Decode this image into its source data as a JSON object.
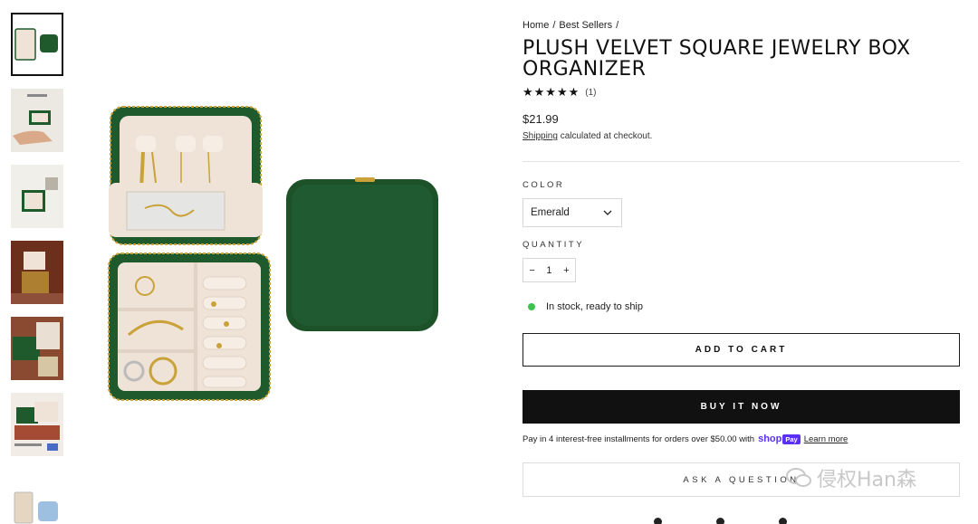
{
  "breadcrumb": [
    "Home",
    "/",
    "Best Sellers",
    "/"
  ],
  "product": {
    "title": "PLUSH VELVET SQUARE JEWELRY BOX ORGANIZER",
    "stars": "★★★★★",
    "review_count": "(1)",
    "price": "$21.99",
    "shipping_link": "Shipping",
    "shipping_text": " calculated at checkout."
  },
  "color": {
    "label": "COLOR",
    "selected": "Emerald"
  },
  "quantity": {
    "label": "QUANTITY",
    "minus": "−",
    "value": "1",
    "plus": "+"
  },
  "stock_text": "In stock, ready to ship",
  "buttons": {
    "add_to_cart": "ADD TO CART",
    "buy_now": "BUY IT NOW",
    "ask": "ASK A QUESTION"
  },
  "pay": {
    "text": "Pay in 4 interest-free installments for orders over $50.00 with",
    "brand": "shop",
    "brand_badge": "Pay",
    "learn": "Learn more"
  },
  "watermark": "侵权Han森",
  "colors": {
    "emerald": "#1f5a2c",
    "cream": "#efe2d6",
    "gold": "#c9a33a",
    "stock": "#3fc24f"
  }
}
